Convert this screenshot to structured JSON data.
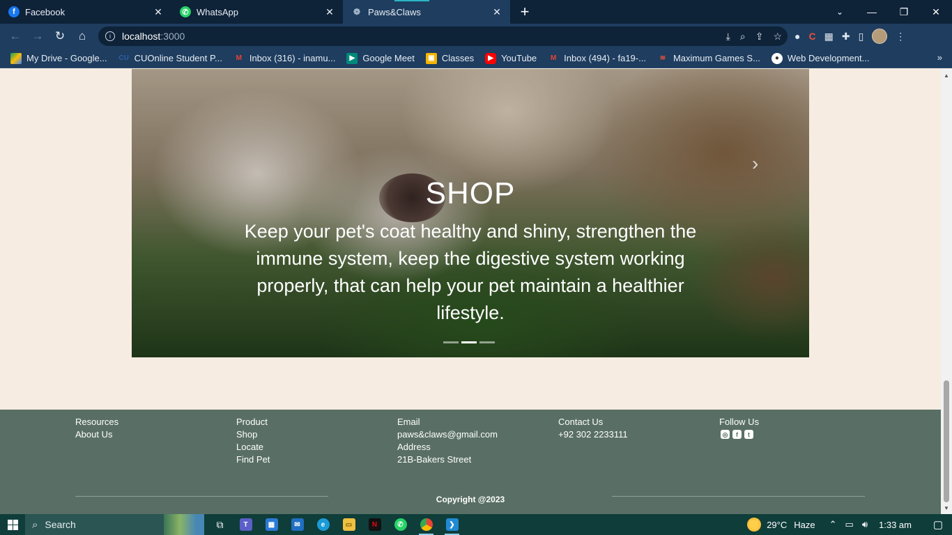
{
  "browser": {
    "tabs": [
      {
        "label": "Facebook",
        "icon": "facebook-icon"
      },
      {
        "label": "WhatsApp",
        "icon": "whatsapp-icon"
      },
      {
        "label": "Paws&Claws",
        "icon": "paw-icon",
        "active": true
      }
    ],
    "address": {
      "host": "localhost",
      "port": ":3000"
    },
    "bookmarks": [
      {
        "label": "My Drive - Google...",
        "icon": "google-drive-icon"
      },
      {
        "label": "CUOnline Student P...",
        "icon": "cu-icon"
      },
      {
        "label": "Inbox (316) - inamu...",
        "icon": "gmail-icon"
      },
      {
        "label": "Google Meet",
        "icon": "google-meet-icon"
      },
      {
        "label": "Classes",
        "icon": "classroom-icon"
      },
      {
        "label": "YouTube",
        "icon": "youtube-icon"
      },
      {
        "label": "Inbox (494) - fa19-...",
        "icon": "gmail-icon"
      },
      {
        "label": "Maximum Games S...",
        "icon": "maximum-games-icon"
      },
      {
        "label": "Web Development...",
        "icon": "web-dev-icon"
      }
    ],
    "more_bookmarks": "»"
  },
  "carousel": {
    "title": "SHOP",
    "text": "Keep your pet's coat healthy and shiny, strengthen the immune system, keep the digestive system working properly, that can help your pet maintain a healthier lifestyle.",
    "slides": 3,
    "active_slide": 2,
    "next_arrow": "›"
  },
  "footer": {
    "resources": {
      "heading": "Resources",
      "links": [
        "About Us"
      ]
    },
    "product": {
      "heading": "Product",
      "links": [
        "Shop",
        "Locate",
        "Find Pet"
      ]
    },
    "contact": {
      "email_heading": "Email",
      "email": "paws&claws@gmail.com",
      "address_heading": "Address",
      "address": "21B-Bakers Street"
    },
    "phone": {
      "heading": "Contact Us",
      "number": "+92 302 2233111"
    },
    "follow": {
      "heading": "Follow Us",
      "icons": [
        "instagram-icon",
        "facebook-icon",
        "twitter-icon"
      ]
    },
    "copyright": "Copyright @2023"
  },
  "taskbar": {
    "search_placeholder": "Search",
    "weather": "29°C",
    "weather_condition": "Haze",
    "time": "1:33 am"
  },
  "colors": {
    "page_bg": "#f6ece2",
    "footer_bg": "#596f65",
    "chrome_dark": "#0e2238",
    "chrome_toolbar": "#1e3d5f",
    "taskbar": "#0f3d3a"
  }
}
